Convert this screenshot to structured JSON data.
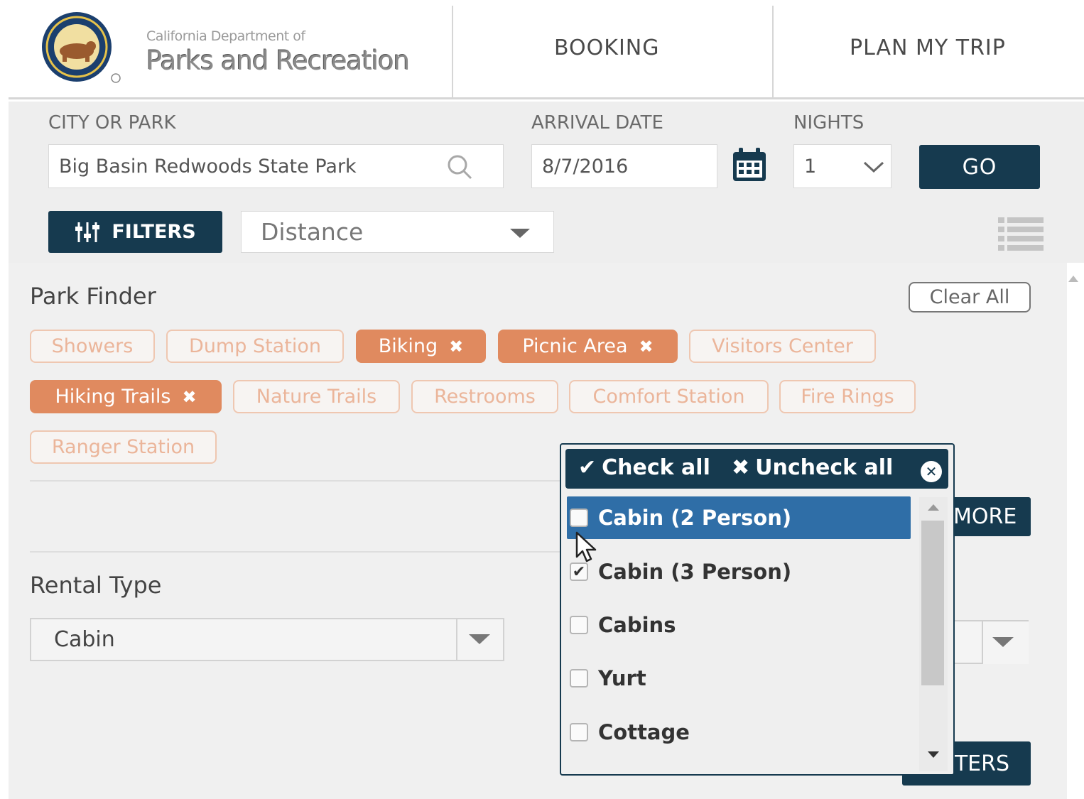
{
  "header": {
    "org_line1": "California Department of",
    "org_line2": "Parks and Recreation",
    "nav": [
      {
        "label": "BOOKING"
      },
      {
        "label": "PLAN MY TRIP"
      }
    ]
  },
  "search": {
    "city_label": "CITY OR PARK",
    "city_value": "Big Basin Redwoods State Park",
    "arrival_label": "ARRIVAL DATE",
    "arrival_value": "8/7/2016",
    "nights_label": "NIGHTS",
    "nights_value": "1",
    "go_label": "GO",
    "filters_label": "FILTERS",
    "sort_value": "Distance"
  },
  "park_finder": {
    "title": "Park Finder",
    "clear_all": "Clear All",
    "amenities": [
      {
        "label": "Showers",
        "active": false
      },
      {
        "label": "Dump Station",
        "active": false
      },
      {
        "label": "Biking",
        "active": true
      },
      {
        "label": "Picnic Area",
        "active": true
      },
      {
        "label": "Visitors Center",
        "active": false
      },
      {
        "label": "Hiking Trails",
        "active": true
      },
      {
        "label": "Nature Trails",
        "active": false
      },
      {
        "label": "Restrooms",
        "active": false
      },
      {
        "label": "Comfort Station",
        "active": false
      },
      {
        "label": "Fire Rings",
        "active": false
      },
      {
        "label": "Ranger Station",
        "active": false
      }
    ],
    "more_button": "MORE",
    "rental_type_title": "Rental Type",
    "rental_type_value": "Cabin",
    "apply_button": "TERS"
  },
  "dropdown": {
    "check_all": "Check all",
    "uncheck_all": "Uncheck all",
    "options": [
      {
        "label": "Cabin (2 Person)",
        "checked": false,
        "highlighted": true
      },
      {
        "label": "Cabin (3 Person)",
        "checked": true,
        "highlighted": false
      },
      {
        "label": "Cabins",
        "checked": false,
        "highlighted": false
      },
      {
        "label": "Yurt",
        "checked": false,
        "highlighted": false
      },
      {
        "label": "Cottage",
        "checked": false,
        "highlighted": false
      }
    ]
  },
  "colors": {
    "primary": "#163a4f",
    "chip_active": "#e08a5f",
    "chip_inactive_text": "#ebb59a",
    "option_highlight": "#2f6ea7"
  },
  "icons": {
    "search": "search-icon",
    "calendar": "calendar-icon",
    "chevron": "chevron-down-icon",
    "filters": "sliders-icon",
    "list": "list-view-icon"
  }
}
